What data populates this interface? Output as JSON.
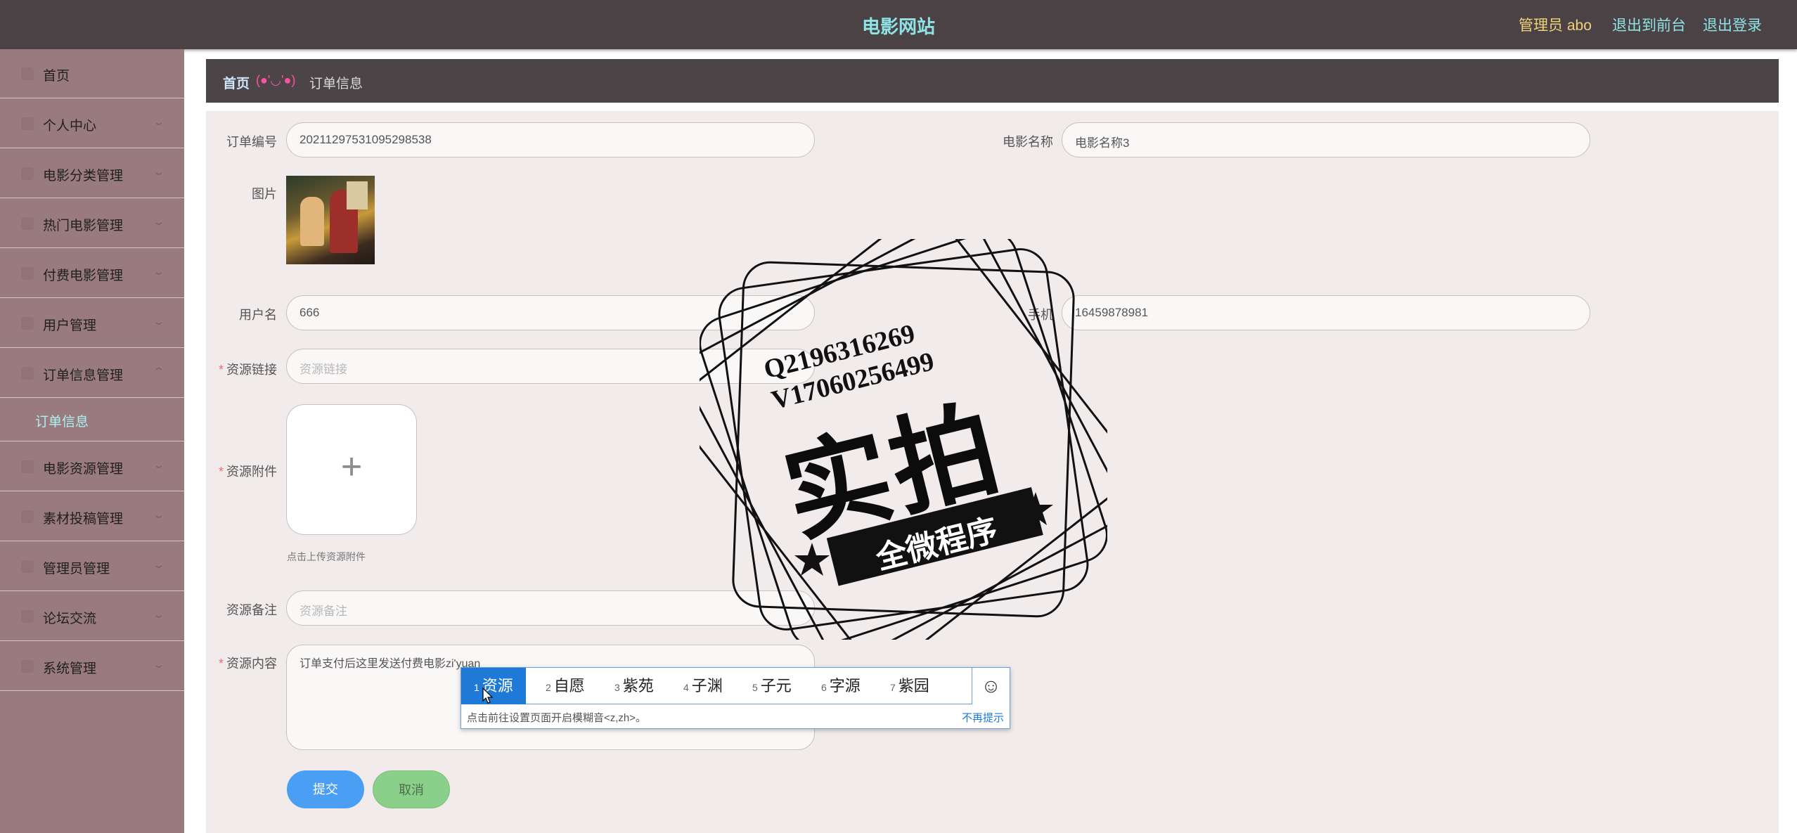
{
  "header": {
    "title": "电影网站",
    "admin": "管理员 abo",
    "links": [
      "退出到前台",
      "退出登录"
    ]
  },
  "sidebar": {
    "items": [
      {
        "label": "首页",
        "icon": "home-icon"
      },
      {
        "label": "个人中心",
        "icon": "user-icon"
      },
      {
        "label": "电影分类管理",
        "icon": "category-icon"
      },
      {
        "label": "热门电影管理",
        "icon": "film-icon"
      },
      {
        "label": "付费电影管理",
        "icon": "payment-icon"
      },
      {
        "label": "用户管理",
        "icon": "users-icon"
      },
      {
        "label": "订单信息管理",
        "icon": "order-icon"
      },
      {
        "label": "订单信息",
        "icon": ""
      },
      {
        "label": "电影资源管理",
        "icon": "resource-icon"
      },
      {
        "label": "素材投稿管理",
        "icon": "upload-icon"
      },
      {
        "label": "管理员管理",
        "icon": "admin-icon"
      },
      {
        "label": "论坛交流",
        "icon": "forum-icon"
      },
      {
        "label": "系统管理",
        "icon": "settings-icon"
      }
    ]
  },
  "breadcrumb": {
    "home": "首页",
    "separator": "(●'◡'●)",
    "current": "订单信息"
  },
  "form": {
    "order_no": {
      "label": "订单编号",
      "value": "20211297531095298538"
    },
    "movie_name": {
      "label": "电影名称",
      "value": "电影名称3"
    },
    "image": {
      "label": "图片"
    },
    "username": {
      "label": "用户名",
      "value": "666"
    },
    "phone": {
      "label": "手机",
      "value": "16459878981"
    },
    "resource_link": {
      "label": "资源链接",
      "placeholder": "资源链接"
    },
    "resource_file": {
      "label": "资源附件",
      "tip": "点击上传资源附件"
    },
    "resource_note": {
      "label": "资源备注",
      "placeholder": "资源备注"
    },
    "resource_content": {
      "label": "资源内容",
      "value": "订单支付后这里发送付费电影zi'yuan"
    },
    "submit": "提交",
    "cancel": "取消"
  },
  "ime": {
    "candidates": [
      {
        "n": "1",
        "text": "资源"
      },
      {
        "n": "2",
        "text": "自愿"
      },
      {
        "n": "3",
        "text": "紫苑"
      },
      {
        "n": "4",
        "text": "子渊"
      },
      {
        "n": "5",
        "text": "子元"
      },
      {
        "n": "6",
        "text": "字源"
      },
      {
        "n": "7",
        "text": "紫园"
      }
    ],
    "emoji": "☺",
    "hint": "点击前往设置页面开启模糊音<z,zh>。",
    "dismiss": "不再提示"
  },
  "watermark": {
    "qq": "Q2196316269",
    "v": "V17060256499",
    "big": "实拍",
    "small": "全微程序"
  },
  "colors": {
    "topbar": "#4a4244",
    "sidebar": "#9a7b7d",
    "accent_cyan": "#8fe3e6",
    "submit": "#4a9ff5",
    "cancel": "#8bd08a"
  }
}
